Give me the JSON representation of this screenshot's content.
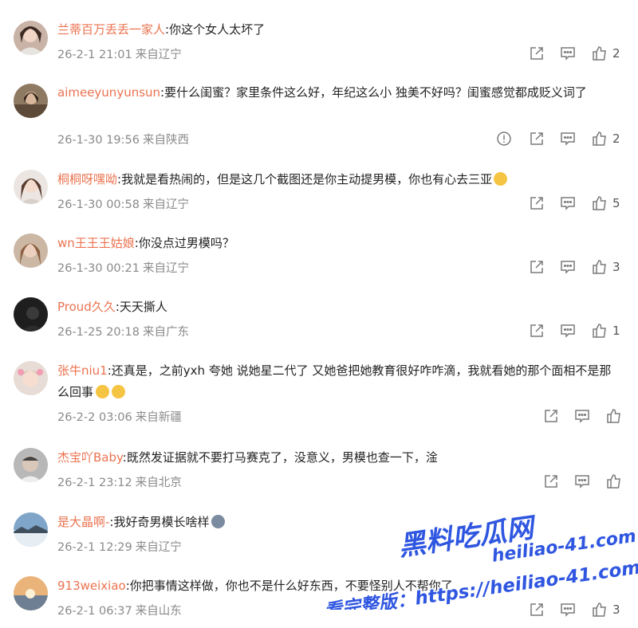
{
  "comments": [
    {
      "username": "兰蒂百万丢丢一家人",
      "text": "你这个女人太坏了",
      "time": "26-2-1 21:01",
      "location": "来自辽宁",
      "likes": "2"
    },
    {
      "username": "aimeeyunyunsun",
      "text": "要什么闺蜜？家里条件这么好，年纪这么小 独美不好吗？闺蜜感觉都成贬义词了",
      "time": "26-1-30 19:56",
      "location": "来自陕西",
      "likes": "2"
    },
    {
      "username": "桐桐呀嘿呦",
      "text": "我就是看热闹的，但是这几个截图还是你主动提男模，你也有心去三亚",
      "time": "26-1-30 00:58",
      "location": "来自辽宁",
      "likes": "5"
    },
    {
      "username": "wn王王王姑娘",
      "text": "你没点过男模吗？",
      "time": "26-1-30 00:21",
      "location": "来自辽宁",
      "likes": "3"
    },
    {
      "username": "Proud久久",
      "text": "天天撕人",
      "time": "26-1-25 20:18",
      "location": "来自广东",
      "likes": "1"
    },
    {
      "username": "张牛niu1",
      "text": "还真是，之前yxh 夸她 说她星二代了 又她爸把她教育很好咋咋滴，我就看她的那个面相不是那么回事",
      "time": "26-2-2 03:06",
      "location": "来自新疆",
      "likes": ""
    },
    {
      "username": "杰宝吖Baby",
      "text": "既然发证据就不要打马赛克了，没意义，男模也查一下，淦",
      "time": "26-2-1 23:12",
      "location": "来自北京",
      "likes": ""
    },
    {
      "username": "是大晶啊-",
      "text": "我好奇男模长啥样",
      "time": "26-2-1 12:29",
      "location": "来自辽宁",
      "likes": ""
    },
    {
      "username": "913weixiao",
      "text": "你把事情这样做，你也不是什么好东西，不要怪别人不帮你了",
      "time": "26-2-1 06:37",
      "location": "来自山东",
      "likes": "3"
    }
  ],
  "watermark": {
    "brand": "黑料吃瓜网",
    "domain": "heiliao-41.com",
    "line": "看完整版：https://heiliao-41.com"
  },
  "colors": {
    "username": "#eb7350",
    "text": "#222222",
    "meta": "#8a8a8a",
    "icon": "#7a7a7a"
  }
}
